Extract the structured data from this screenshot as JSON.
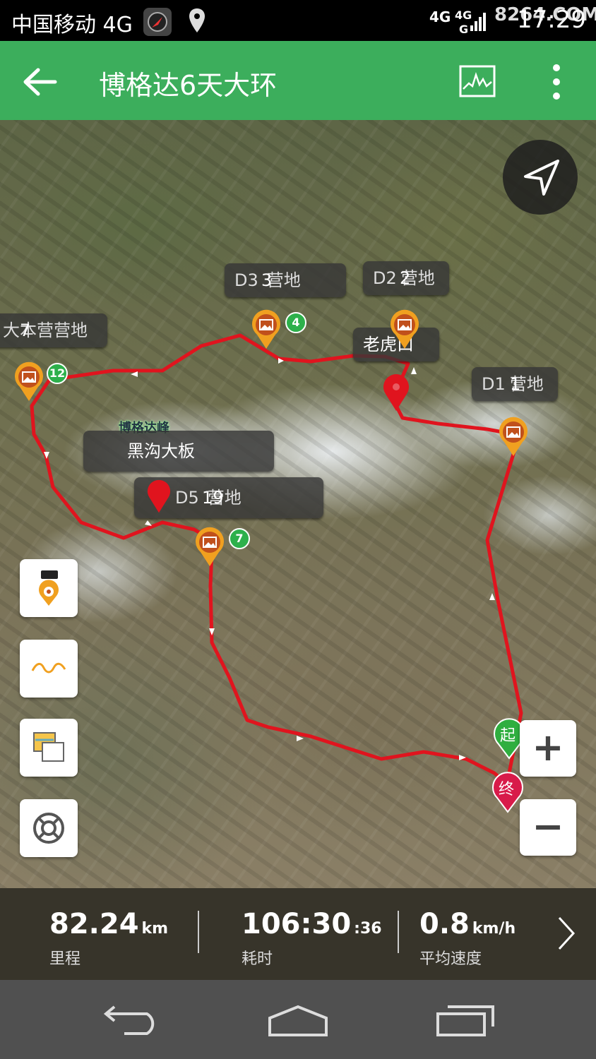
{
  "status_bar": {
    "carrier": "中国移动 4G",
    "network_1": "4G",
    "network_2": "4G",
    "network_3": "G",
    "watermark": "8264.COM",
    "time": "17:29"
  },
  "toolbar": {
    "title": "博格达6天大环",
    "back_icon": "arrow-left-icon",
    "chart_icon": "elevation-chart-icon",
    "more_icon": "more-vert-icon",
    "color": "#3cae5c"
  },
  "map": {
    "route_color": "#e0141e",
    "waypoints": [
      {
        "label": "D3",
        "label_suffix": "营地",
        "number": "3",
        "badge": "4"
      },
      {
        "label": "D2",
        "label_suffix": "营地",
        "number": "2",
        "badge": ""
      },
      {
        "label": "大本营营地",
        "number": "7",
        "badge": "12"
      },
      {
        "label": "D1",
        "label_suffix": "营地",
        "number": "1",
        "badge": ""
      },
      {
        "label": "D5",
        "label_suffix": "营地",
        "number": "19",
        "badge": "7"
      }
    ],
    "markers": [
      {
        "label": "老虎口"
      },
      {
        "label": "黑沟大板"
      }
    ],
    "peak_label": "博格达峰",
    "start_label": "起",
    "end_label": "终"
  },
  "controls": {
    "zoom_in": "+",
    "zoom_out": "−"
  },
  "stats": {
    "distance": {
      "value": "82.24",
      "unit": "km",
      "label": "里程"
    },
    "duration": {
      "value": "106:30",
      "suffix": ":36",
      "label": "耗时"
    },
    "speed": {
      "value": "0.8",
      "unit": "km/h",
      "label": "平均速度"
    }
  }
}
